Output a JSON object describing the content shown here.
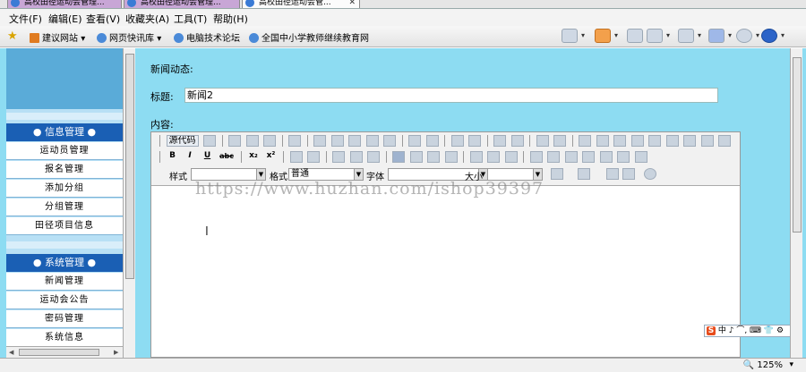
{
  "tabs": [
    {
      "label": "高校田径运动会管理...",
      "active": false
    },
    {
      "label": "高校田径运动会管理...",
      "active": false
    },
    {
      "label": "高校田径运动会管...",
      "active": true
    }
  ],
  "menubar": [
    "文件(F)",
    "编辑(E)",
    "查看(V)",
    "收藏夹(A)",
    "工具(T)",
    "帮助(H)"
  ],
  "favorites": [
    {
      "label": "建议网站",
      "caret": "▾"
    },
    {
      "label": "网页快讯库",
      "caret": "▾"
    },
    {
      "label": "电脑技术论坛",
      "caret": ""
    },
    {
      "label": "全国中小学教师继续教育网",
      "caret": ""
    }
  ],
  "sidebar": {
    "sections": [
      {
        "title": "● 信息管理 ●",
        "items": [
          "运动员管理",
          "报名管理",
          "添加分组",
          "分组管理",
          "田径项目信息"
        ]
      },
      {
        "title": "● 系统管理 ●",
        "items": [
          "新闻管理",
          "运动会公告",
          "密码管理",
          "系统信息"
        ]
      }
    ]
  },
  "main": {
    "heading": "新闻动态:",
    "title_label": "标题:",
    "title_value": "新闻2",
    "content_label": "内容:"
  },
  "editor": {
    "row1": {
      "source_label": "源代码"
    },
    "row2": {
      "bold": "B",
      "italic": "I",
      "underline": "U",
      "strike": "abc",
      "sub": "x₂",
      "sup": "x²"
    },
    "row3": {
      "style_label": "样式",
      "format_label": "格式",
      "format_value": "普通",
      "font_label": "字体",
      "size_label": "大小"
    }
  },
  "ime": {
    "logo": "S",
    "text": "中 ♪ ⌒, ⌨ 👕 ⚙"
  },
  "watermark": "https://www.huzhan.com/ishop39397",
  "statusbar": {
    "zoom": "🔍 125%",
    "zoom_caret": "▾"
  },
  "colors": {
    "sidebar_header": "#1a5fb4",
    "page_bg": "#8ddcf2",
    "sidebar_top": "#5aabd8"
  }
}
